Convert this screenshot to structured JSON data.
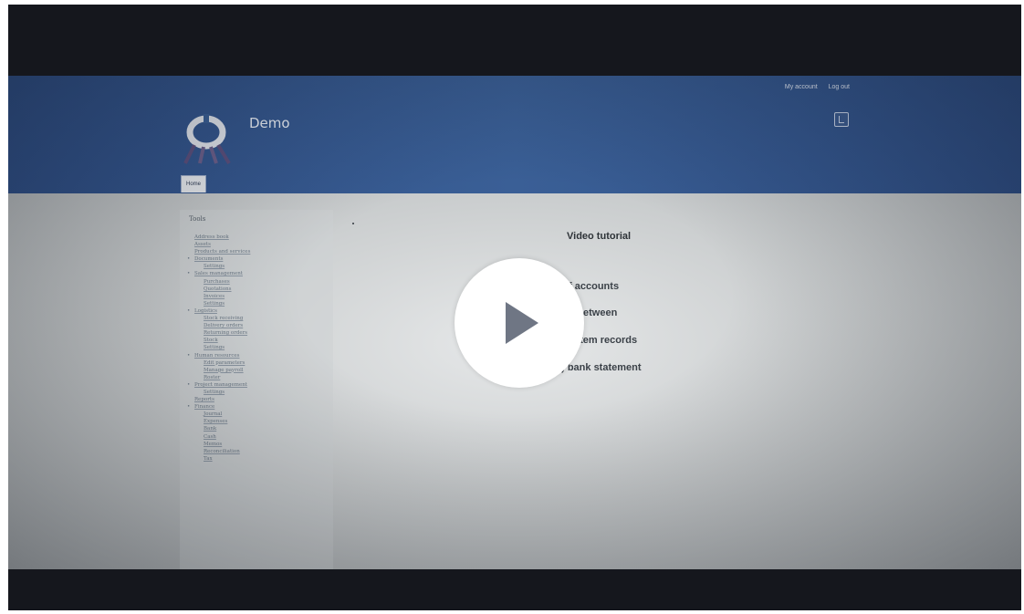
{
  "video": {
    "title": "Video tutorial",
    "lines": [
      "ation of accounts",
      "etween",
      "stem records",
      "2) bank statement"
    ],
    "play_icon": "play-icon"
  },
  "header": {
    "site_name": "Demo",
    "top_links": [
      "My account",
      "Log out"
    ],
    "tab_home": "Home",
    "icon": "document-icon"
  },
  "sidebar": {
    "title": "Tools",
    "items": [
      {
        "label": "Address book",
        "level": 1,
        "bullet": false
      },
      {
        "label": "Assets",
        "level": 1,
        "bullet": false
      },
      {
        "label": "Products and services",
        "level": 1,
        "bullet": false
      },
      {
        "label": "Documents",
        "level": 1,
        "bullet": true
      },
      {
        "label": "Settings",
        "level": 2,
        "bullet": false
      },
      {
        "label": "Sales management",
        "level": 1,
        "bullet": true
      },
      {
        "label": "Purchases",
        "level": 2,
        "bullet": false
      },
      {
        "label": "Quotations",
        "level": 2,
        "bullet": false
      },
      {
        "label": "Invoices",
        "level": 2,
        "bullet": false
      },
      {
        "label": "Settings",
        "level": 2,
        "bullet": false
      },
      {
        "label": "Logistics",
        "level": 1,
        "bullet": true
      },
      {
        "label": "Stock receiving",
        "level": 2,
        "bullet": false
      },
      {
        "label": "Delivery orders",
        "level": 2,
        "bullet": false
      },
      {
        "label": "Returning orders",
        "level": 2,
        "bullet": false
      },
      {
        "label": "Stock",
        "level": 2,
        "bullet": false
      },
      {
        "label": "Settings",
        "level": 2,
        "bullet": false
      },
      {
        "label": "Human resources",
        "level": 1,
        "bullet": true
      },
      {
        "label": "Edit parameters",
        "level": 2,
        "bullet": false
      },
      {
        "label": "Manage payroll",
        "level": 2,
        "bullet": false
      },
      {
        "label": "Roster",
        "level": 2,
        "bullet": false
      },
      {
        "label": "Project management",
        "level": 1,
        "bullet": true
      },
      {
        "label": "Settings",
        "level": 2,
        "bullet": false
      },
      {
        "label": "Reports",
        "level": 1,
        "bullet": false
      },
      {
        "label": "Finance",
        "level": 1,
        "bullet": true
      },
      {
        "label": "Journal",
        "level": 2,
        "bullet": false
      },
      {
        "label": "Expenses",
        "level": 2,
        "bullet": false
      },
      {
        "label": "Bank",
        "level": 2,
        "bullet": false
      },
      {
        "label": "Cash",
        "level": 2,
        "bullet": false
      },
      {
        "label": "Memos",
        "level": 2,
        "bullet": false
      },
      {
        "label": "Reconciliation",
        "level": 2,
        "bullet": false
      },
      {
        "label": "Tax",
        "level": 2,
        "bullet": false
      }
    ]
  }
}
